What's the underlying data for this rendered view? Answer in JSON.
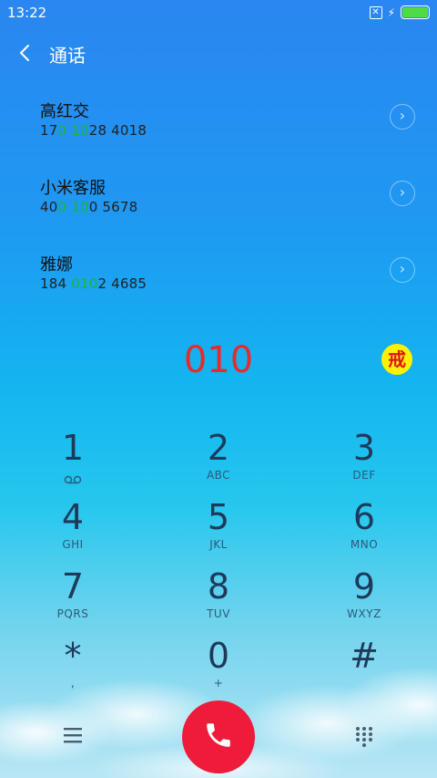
{
  "status": {
    "time": "13:22"
  },
  "header": {
    "title": "通话"
  },
  "contacts": [
    {
      "name": "高红交",
      "num_pre": "17",
      "num_hl": "0 10",
      "num_post": "28 4018"
    },
    {
      "name": "小米客服",
      "num_pre": "40",
      "num_hl": "0 10",
      "num_post": "0 5678"
    },
    {
      "name": "雅娜",
      "num_pre": "184 ",
      "num_hl": "010",
      "num_post": "2 4685"
    }
  ],
  "dialed": "010",
  "badge": "戒",
  "keys": [
    {
      "digit": "1",
      "letters": ""
    },
    {
      "digit": "2",
      "letters": "ABC"
    },
    {
      "digit": "3",
      "letters": "DEF"
    },
    {
      "digit": "4",
      "letters": "GHI"
    },
    {
      "digit": "5",
      "letters": "JKL"
    },
    {
      "digit": "6",
      "letters": "MNO"
    },
    {
      "digit": "7",
      "letters": "PQRS"
    },
    {
      "digit": "8",
      "letters": "TUV"
    },
    {
      "digit": "9",
      "letters": "WXYZ"
    },
    {
      "digit": "*",
      "letters": ","
    },
    {
      "digit": "0",
      "letters": "+"
    },
    {
      "digit": "#",
      "letters": ""
    }
  ],
  "icons": {
    "back": "chevron-left-icon",
    "menu": "menu-icon",
    "call": "phone-icon",
    "dialpad": "dialpad-icon",
    "voicemail": "voicemail-icon"
  }
}
